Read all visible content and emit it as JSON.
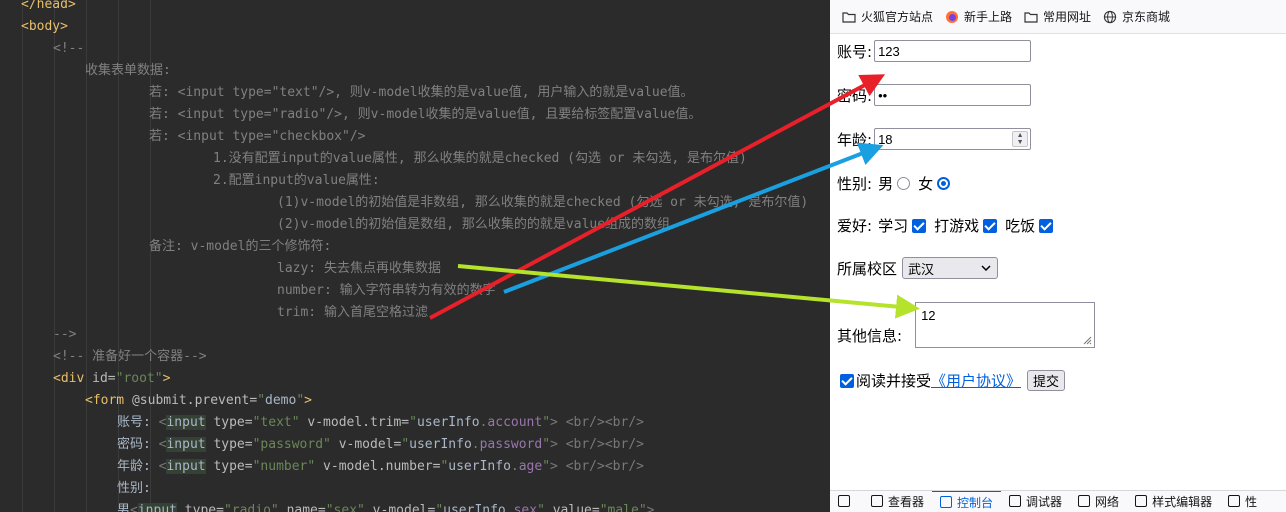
{
  "editor": {
    "lines": [
      {
        "indent": 0,
        "parts": [
          [
            "tag",
            "</head>"
          ]
        ]
      },
      {
        "indent": 0,
        "parts": [
          [
            "tag",
            "<body>"
          ]
        ]
      },
      {
        "indent": 1,
        "parts": [
          [
            "cmt",
            "<!--"
          ]
        ]
      },
      {
        "indent": 2,
        "parts": [
          [
            "cmt",
            "收集表单数据:"
          ]
        ]
      },
      {
        "indent": 4,
        "parts": [
          [
            "cmt",
            "若: <input type=\"text\"/>, 则v-model收集的是value值, 用户输入的就是value值。"
          ]
        ]
      },
      {
        "indent": 4,
        "parts": [
          [
            "cmt",
            "若: <input type=\"radio\"/>, 则v-model收集的是value值, 且要给标签配置value值。"
          ]
        ]
      },
      {
        "indent": 4,
        "parts": [
          [
            "cmt",
            "若: <input type=\"checkbox\"/>"
          ]
        ]
      },
      {
        "indent": 6,
        "parts": [
          [
            "cmt",
            "1.没有配置input的value属性, 那么收集的就是checked (勾选 or 未勾选, 是布尔值)"
          ]
        ]
      },
      {
        "indent": 6,
        "parts": [
          [
            "cmt",
            "2.配置input的value属性:"
          ]
        ]
      },
      {
        "indent": 8,
        "parts": [
          [
            "cmt",
            "(1)v-model的初始值是非数组, 那么收集的就是checked (勾选 or 未勾选, 是布尔值)"
          ]
        ]
      },
      {
        "indent": 8,
        "parts": [
          [
            "cmt",
            "(2)v-model的初始值是数组, 那么收集的的就是value组成的数组"
          ]
        ]
      },
      {
        "indent": 4,
        "parts": [
          [
            "cmt",
            "备注: v-model的三个修饰符:"
          ]
        ]
      },
      {
        "indent": 8,
        "parts": [
          [
            "cmt",
            "lazy: 失去焦点再收集数据"
          ]
        ]
      },
      {
        "indent": 8,
        "parts": [
          [
            "cmt",
            "number: 输入字符串转为有效的数字"
          ]
        ]
      },
      {
        "indent": 8,
        "parts": [
          [
            "cmt",
            "trim: 输入首尾空格过滤"
          ]
        ]
      },
      {
        "indent": 1,
        "parts": [
          [
            "cmt",
            "-->"
          ]
        ]
      },
      {
        "indent": 1,
        "parts": [
          [
            "cmt",
            "<!-- 准备好一个容器-->"
          ]
        ]
      },
      {
        "indent": 1,
        "parts": [
          [
            "tag",
            "<div "
          ],
          [
            "attr",
            "id="
          ],
          [
            "str",
            "\"root\""
          ],
          [
            "tag",
            ">"
          ]
        ]
      },
      {
        "indent": 2,
        "parts": [
          [
            "tag",
            "<form "
          ],
          [
            "attr",
            "@submit.prevent="
          ],
          [
            "str",
            "\""
          ],
          [
            "val",
            "demo"
          ],
          [
            "str",
            "\""
          ],
          [
            "tag",
            ">"
          ]
        ]
      },
      {
        "indent": 3,
        "parts": [
          [
            "val",
            "账号: "
          ],
          [
            "dim",
            "<"
          ],
          [
            "hl",
            "input"
          ],
          [
            "attr",
            " type="
          ],
          [
            "str",
            "\"text\""
          ],
          [
            "attr",
            " v-model.trim="
          ],
          [
            "str",
            "\""
          ],
          [
            "val",
            "userInfo"
          ],
          [
            "str",
            "."
          ],
          [
            "prop",
            "account"
          ],
          [
            "str",
            "\""
          ],
          [
            "dim",
            "> <br/><br/>"
          ]
        ]
      },
      {
        "indent": 3,
        "parts": [
          [
            "val",
            "密码: "
          ],
          [
            "dim",
            "<"
          ],
          [
            "hl",
            "input"
          ],
          [
            "attr",
            " type="
          ],
          [
            "str",
            "\"password\""
          ],
          [
            "attr",
            " v-model="
          ],
          [
            "str",
            "\""
          ],
          [
            "val",
            "userInfo"
          ],
          [
            "str",
            "."
          ],
          [
            "prop",
            "password"
          ],
          [
            "str",
            "\""
          ],
          [
            "dim",
            "> <br/><br/>"
          ]
        ]
      },
      {
        "indent": 3,
        "parts": [
          [
            "val",
            "年龄: "
          ],
          [
            "dim",
            "<"
          ],
          [
            "hl",
            "input"
          ],
          [
            "attr",
            " type="
          ],
          [
            "str",
            "\"number\""
          ],
          [
            "attr",
            " v-model.number="
          ],
          [
            "str",
            "\""
          ],
          [
            "val",
            "userInfo"
          ],
          [
            "str",
            "."
          ],
          [
            "prop",
            "age"
          ],
          [
            "str",
            "\""
          ],
          [
            "dim",
            "> <br/><br/>"
          ]
        ]
      },
      {
        "indent": 3,
        "parts": [
          [
            "val",
            "性别:"
          ]
        ]
      },
      {
        "indent": 3,
        "parts": [
          [
            "val",
            "男"
          ],
          [
            "dim",
            "<"
          ],
          [
            "hl",
            "input"
          ],
          [
            "attr",
            " type="
          ],
          [
            "str",
            "\"radio\""
          ],
          [
            "attr",
            " name="
          ],
          [
            "str",
            "\"sex\""
          ],
          [
            "attr",
            " v-model="
          ],
          [
            "str",
            "\""
          ],
          [
            "val",
            "userInfo"
          ],
          [
            "str",
            "."
          ],
          [
            "prop",
            "sex"
          ],
          [
            "str",
            "\""
          ],
          [
            "attr",
            " value="
          ],
          [
            "str",
            "\"male\""
          ],
          [
            "dim",
            ">"
          ]
        ]
      }
    ]
  },
  "bookmarks": [
    {
      "label": "火狐官方站点",
      "icon": "folder-icon"
    },
    {
      "label": "新手上路",
      "icon": "firefox-icon"
    },
    {
      "label": "常用网址",
      "icon": "folder-icon"
    },
    {
      "label": "京东商城",
      "icon": "globe-icon"
    }
  ],
  "form": {
    "account_label": "账号:",
    "account_value": "123",
    "password_label": "密码:",
    "password_value": "••",
    "age_label": "年龄:",
    "age_value": "18",
    "sex_label": "性别:",
    "sex_male": "男",
    "sex_female": "女",
    "hobby_label": "爱好:",
    "hobby_study": "学习",
    "hobby_game": "打游戏",
    "hobby_eat": "吃饭",
    "campus_label": "所属校区",
    "campus_value": "武汉",
    "other_label": "其他信息:",
    "other_value": "12",
    "agree_text": "阅读并接受",
    "agree_link": "《用户协议》",
    "submit_label": "提交"
  },
  "devtools": {
    "tabs": [
      {
        "label": "",
        "active": false
      },
      {
        "label": "查看器",
        "active": false
      },
      {
        "label": "控制台",
        "active": true
      },
      {
        "label": "调试器",
        "active": false
      },
      {
        "label": "网络",
        "active": false
      },
      {
        "label": "样式编辑器",
        "active": false
      },
      {
        "label": "性",
        "active": false
      }
    ]
  },
  "colors": {
    "arrow_trim": "#e8202a",
    "arrow_number": "#1aa0e0",
    "arrow_lazy": "#b5e22a",
    "accent": "#0060df"
  }
}
